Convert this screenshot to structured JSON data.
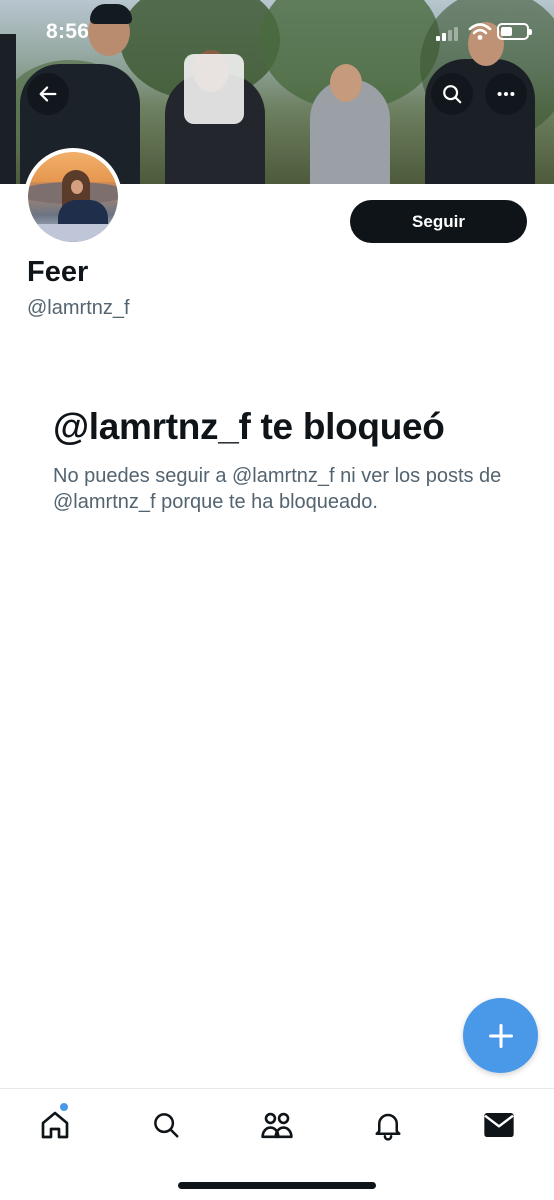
{
  "status_bar": {
    "time": "8:56"
  },
  "header": {
    "back_icon": "arrow-left-icon",
    "search_icon": "search-icon",
    "more_icon": "more-horizontal-icon"
  },
  "profile": {
    "display_name": "Feer",
    "handle": "@lamrtnz_f",
    "follow_label": "Seguir"
  },
  "blocked": {
    "title": "@lamrtnz_f te bloqueó",
    "message": "No puedes seguir a @lamrtnz_f ni ver los posts de @lamrtnz_f porque te ha bloqueado."
  },
  "fab": {
    "icon": "plus-icon"
  },
  "bottom_nav": {
    "items": [
      {
        "name": "home",
        "icon": "home-icon",
        "has_notification_dot": true
      },
      {
        "name": "search",
        "icon": "search-icon"
      },
      {
        "name": "communities",
        "icon": "communities-icon"
      },
      {
        "name": "notifications",
        "icon": "bell-icon"
      },
      {
        "name": "messages",
        "icon": "envelope-icon"
      }
    ]
  },
  "colors": {
    "text_primary": "#0f1419",
    "text_secondary": "#536471",
    "accent": "#4a99e9",
    "button_dark": "#0f1419"
  }
}
